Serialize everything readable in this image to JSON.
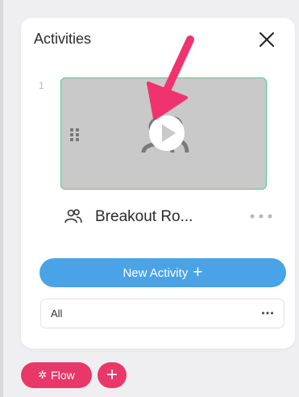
{
  "panel": {
    "title": "Activities",
    "close_icon": "close-icon"
  },
  "activity": {
    "index": "1",
    "label": "Breakout Ro...",
    "icon": "group-icon",
    "more_icon": "more-horizontal-icon"
  },
  "thumbnail": {
    "handle_icon": "drag-handle-icon",
    "center_icon": "group-icon",
    "play_icon": "play-icon"
  },
  "new_activity": {
    "label": "New Activity"
  },
  "filter": {
    "label": "All",
    "more_icon": "more-horizontal-icon"
  },
  "footer": {
    "flow_label": "Flow",
    "add_icon": "plus-icon"
  },
  "colors": {
    "accent_blue": "#4aa3e6",
    "accent_pink": "#e8386a",
    "thumb_border": "#5cc58a",
    "annotation_arrow": "#f0336f"
  }
}
